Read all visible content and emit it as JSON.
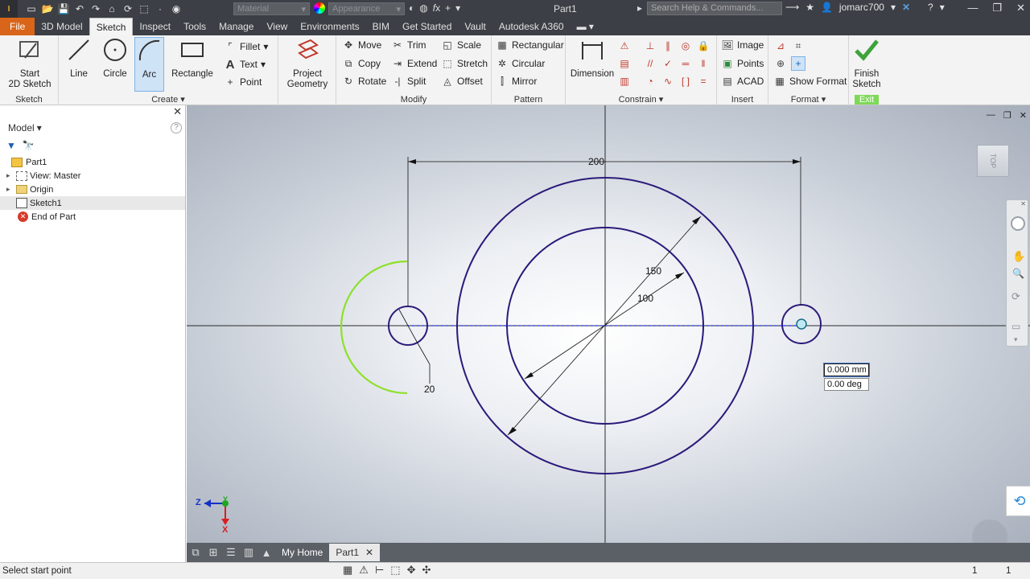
{
  "app": {
    "title": "Part1",
    "logo_text": "I",
    "material_placeholder": "Material",
    "appearance_placeholder": "Appearance",
    "search_placeholder": "Search Help & Commands...",
    "user": "jomarc700"
  },
  "menu": [
    "File",
    "3D Model",
    "Sketch",
    "Inspect",
    "Tools",
    "Manage",
    "View",
    "Environments",
    "BIM",
    "Get Started",
    "Vault",
    "Autodesk A360"
  ],
  "active_menu": "Sketch",
  "ribbon": {
    "sketch_panel": {
      "start_line1": "Start",
      "start_line2": "2D Sketch",
      "label": "Sketch"
    },
    "create_panel": {
      "line": "Line",
      "circle": "Circle",
      "arc": "Arc",
      "rectangle": "Rectangle",
      "fillet": "Fillet",
      "text": "Text",
      "point": "Point",
      "label": "Create"
    },
    "project_panel": {
      "line1": "Project",
      "line2": "Geometry"
    },
    "modify_panel": {
      "move": "Move",
      "copy": "Copy",
      "rotate": "Rotate",
      "trim": "Trim",
      "extend": "Extend",
      "split": "Split",
      "scale": "Scale",
      "stretch": "Stretch",
      "offset": "Offset",
      "label": "Modify"
    },
    "pattern_panel": {
      "rectangular": "Rectangular",
      "circular": "Circular",
      "mirror": "Mirror",
      "label": "Pattern"
    },
    "constrain_panel": {
      "dimension": "Dimension",
      "label": "Constrain"
    },
    "insert_panel": {
      "image": "Image",
      "points": "Points",
      "acad": "ACAD",
      "label": "Insert"
    },
    "format_panel": {
      "show_format": "Show Format",
      "label": "Format"
    },
    "exit_panel": {
      "line1": "Finish",
      "line2": "Sketch",
      "label": "Exit"
    }
  },
  "browser": {
    "title": "Model",
    "items": [
      {
        "label": "Part1",
        "icon": "part-icon",
        "indent": 0
      },
      {
        "label": "View: Master",
        "icon": "view-icon",
        "indent": 1
      },
      {
        "label": "Origin",
        "icon": "folder-icon",
        "indent": 1
      },
      {
        "label": "Sketch1",
        "icon": "sketch-icon",
        "indent": 1
      },
      {
        "label": "End of Part",
        "icon": "end-of-part-icon",
        "indent": 1
      }
    ]
  },
  "viewport": {
    "dim_200": "200",
    "dim_150": "150",
    "dim_100": "100",
    "dim_20": "20",
    "input_length": "0.000 mm",
    "input_angle": "0.00 deg",
    "viewcube_face": "TOP",
    "axis_z": "Z",
    "axis_y": "Y",
    "axis_x": "X"
  },
  "doc_tabs": {
    "home": "My Home",
    "part": "Part1"
  },
  "status": {
    "prompt": "Select start point",
    "right1": "1",
    "right2": "1"
  },
  "colors": {
    "sketch_geometry": "#2b1a7a",
    "preview_arc": "#8ee02a",
    "file_tab": "#d9651a",
    "exit_green": "#7ed957"
  }
}
